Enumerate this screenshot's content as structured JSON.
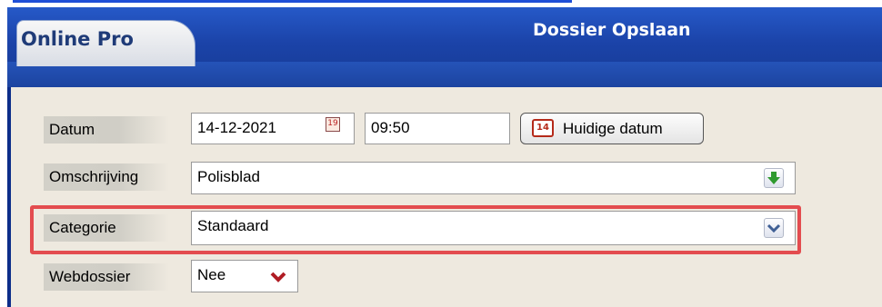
{
  "app": {
    "tab_label": "Online Pro",
    "page_title": "Dossier Opslaan"
  },
  "form": {
    "datum": {
      "label": "Datum",
      "date": "14-12-2021",
      "time": "09:50",
      "calendar_icon": "19"
    },
    "today_button": {
      "label": "Huidige datum",
      "icon": "14"
    },
    "omschrijving": {
      "label": "Omschrijving",
      "value": "Polisblad"
    },
    "categorie": {
      "label": "Categorie",
      "value": "Standaard"
    },
    "webdossier": {
      "label": "Webdossier",
      "value": "Nee"
    }
  },
  "colors": {
    "titlebar": "#1b43a8",
    "form_bg": "#eee9df",
    "highlight": "#e34c4f",
    "green_arrow": "#2f9a2f",
    "red_chevron": "#b01c24",
    "blue_chevron": "#3f5f95"
  }
}
